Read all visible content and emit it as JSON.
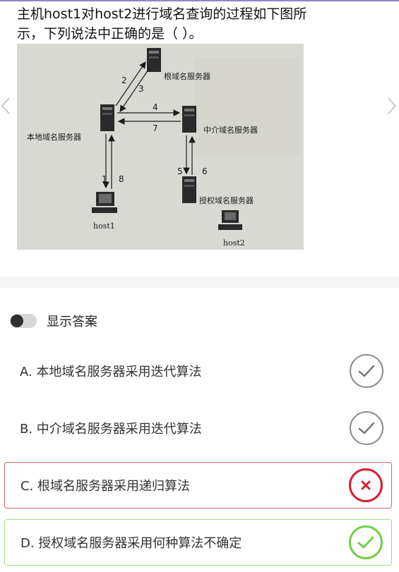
{
  "question": {
    "line1": "主机host1对host2进行域名查询的过程如下图所",
    "line2": "示，下列说法中正确的是（ ）。"
  },
  "figure": {
    "root_label": "根域名服务器",
    "local_label": "本地域名服务器",
    "intermediate_label": "中介域名服务器",
    "authoritative_label": "授权域名服务器",
    "host1_label": "host1",
    "host2_label": "host2",
    "steps": [
      "1",
      "2",
      "3",
      "4",
      "5",
      "6",
      "7",
      "8"
    ]
  },
  "toggle": {
    "label": "显示答案",
    "state": "off"
  },
  "options": [
    {
      "label": "A. 本地域名服务器采用迭代算法",
      "status": "neutral",
      "icon": "check-icon"
    },
    {
      "label": "B. 中介域名服务器采用迭代算法",
      "status": "neutral",
      "icon": "check-icon"
    },
    {
      "label": "C. 根域名服务器采用递归算法",
      "status": "wrong",
      "icon": "cross-icon"
    },
    {
      "label": "D. 授权域名服务器采用何种算法不确定",
      "status": "correct",
      "icon": "check-icon"
    }
  ],
  "colors": {
    "wrong": "#d81e2f",
    "correct": "#6fcf45",
    "neutral": "#8c8c8c"
  }
}
